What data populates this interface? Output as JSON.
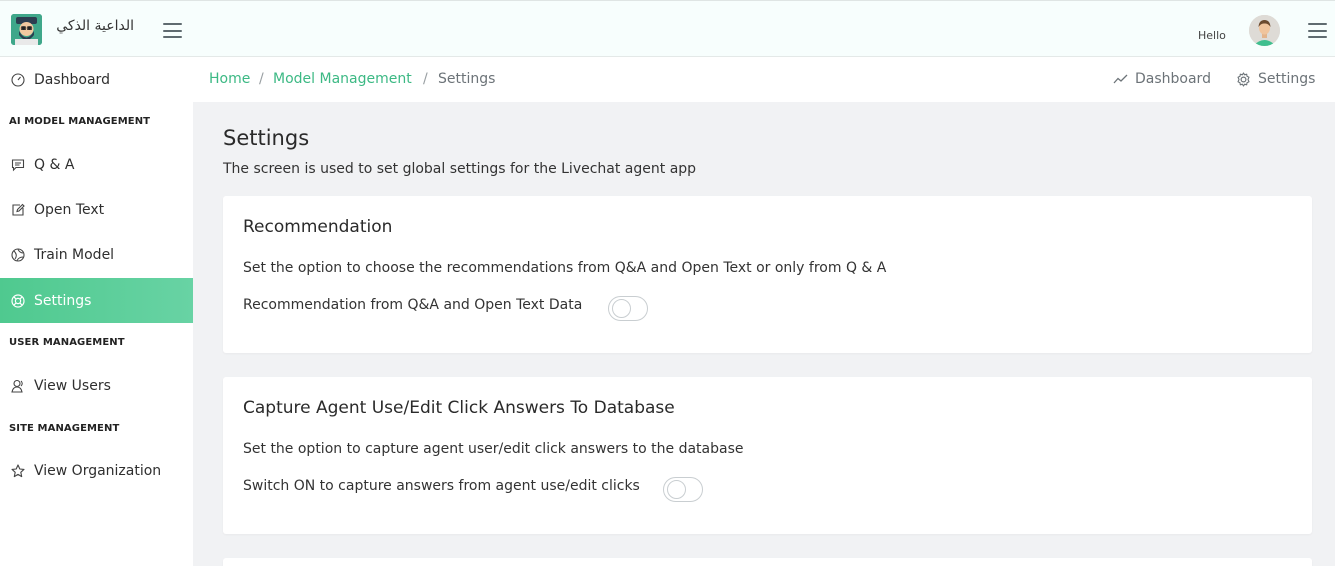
{
  "header": {
    "brand_name": "الداعية الذكي",
    "greeting": "Hello"
  },
  "sidebar": {
    "items": [
      {
        "label": "Dashboard",
        "icon": "speedometer-icon"
      },
      {
        "label": "Q & A",
        "icon": "chat-icon"
      },
      {
        "label": "Open Text",
        "icon": "edit-icon"
      },
      {
        "label": "Train Model",
        "icon": "globe-icon"
      },
      {
        "label": "Settings",
        "icon": "support-icon",
        "active": true
      },
      {
        "label": "View Users",
        "icon": "user-icon"
      },
      {
        "label": "View Organization",
        "icon": "star-icon"
      }
    ],
    "sections": [
      "AI MODEL MANAGEMENT",
      "USER MANAGEMENT",
      "SITE MANAGEMENT"
    ]
  },
  "breadcrumb": {
    "items": [
      "Home",
      "Model Management",
      "Settings"
    ],
    "separator": "/"
  },
  "quick_links": {
    "dashboard": "Dashboard",
    "settings": "Settings"
  },
  "page": {
    "title": "Settings",
    "description": "The screen is used to set global settings for the Livechat agent app"
  },
  "cards": [
    {
      "title": "Recommendation",
      "description": "Set the option to choose the recommendations from Q&A and Open Text or only from Q & A",
      "toggle_label": "Recommendation from Q&A and Open Text Data",
      "toggle_on": false
    },
    {
      "title": "Capture Agent Use/Edit Click Answers To Database",
      "description": "Set the option to capture agent user/edit click answers to the database",
      "toggle_label": "Switch ON to capture answers from agent use/edit clicks",
      "toggle_on": false
    }
  ],
  "colors": {
    "accent": "#3cb984",
    "active_nav": "#4fc98f",
    "content_bg": "#f1f2f4"
  }
}
